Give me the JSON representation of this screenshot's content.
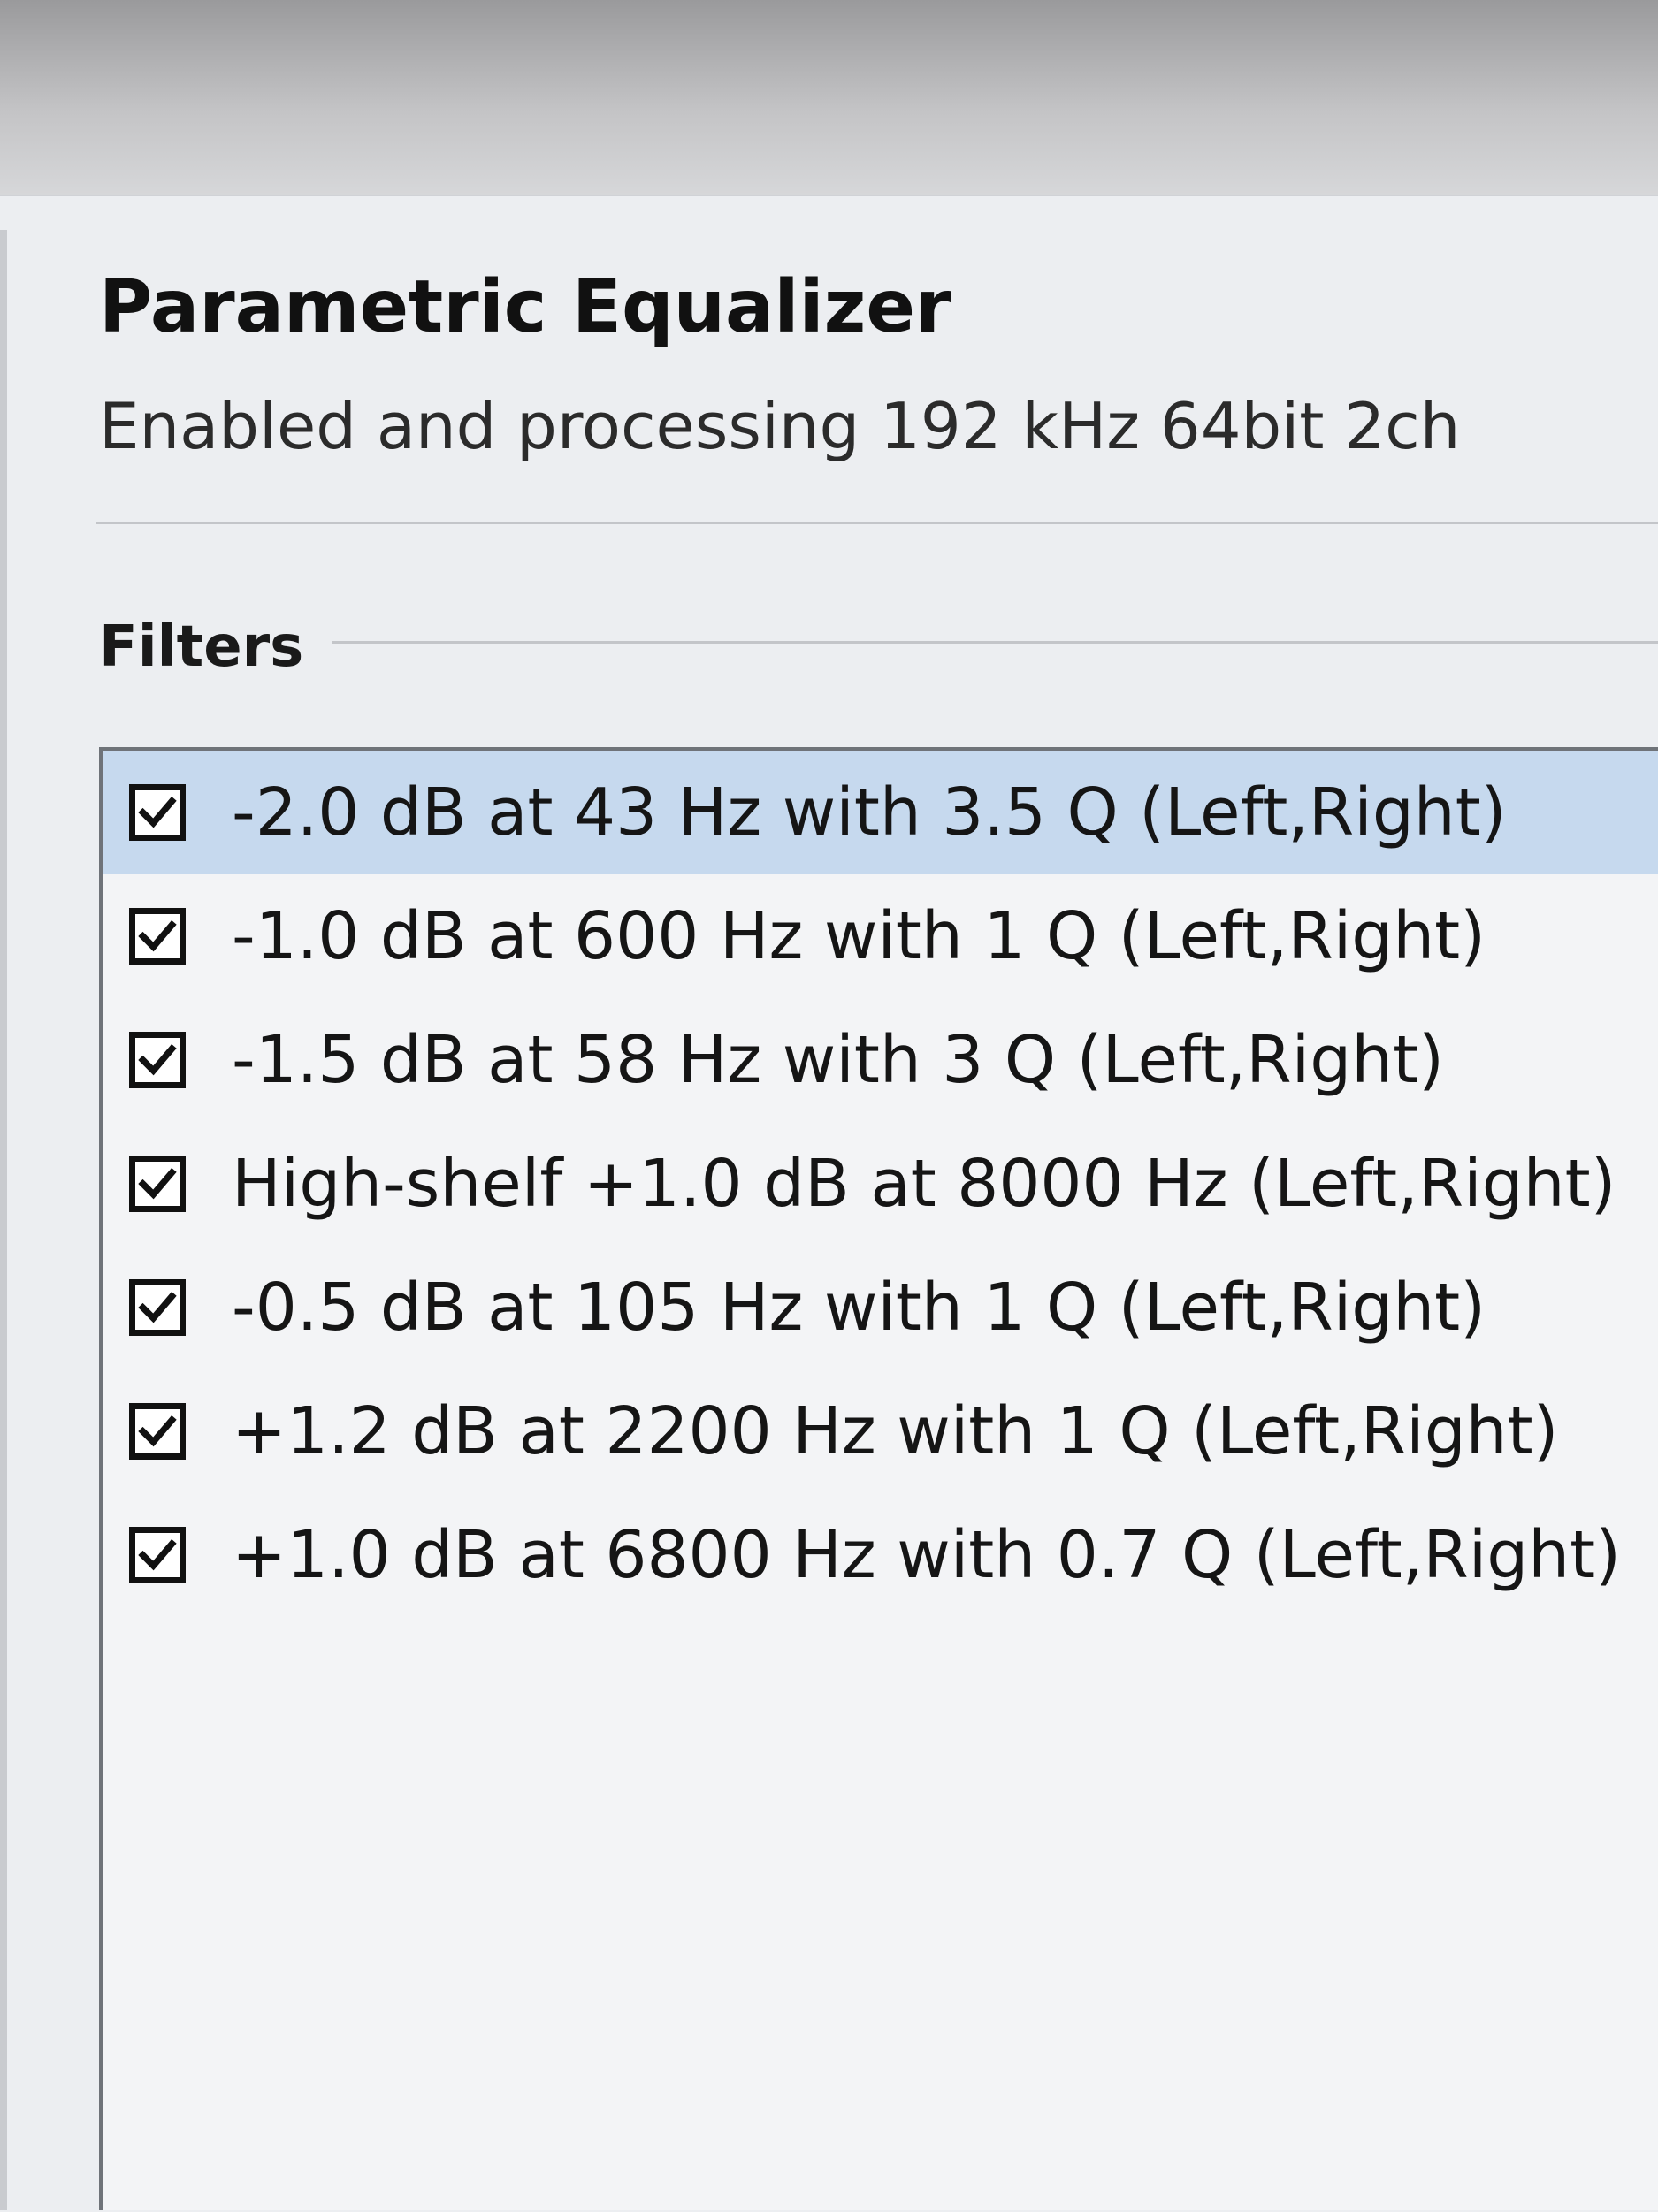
{
  "window": {
    "title": "Parametric Equalizer",
    "status": "Enabled and processing 192 kHz 64bit 2ch"
  },
  "filters_section": {
    "label": "Filters",
    "items": [
      {
        "label": "-2.0 dB at 43 Hz with 3.5 Q (Left,Right)",
        "checked": true,
        "selected": true
      },
      {
        "label": "-1.0 dB at 600 Hz with 1 Q (Left,Right)",
        "checked": true,
        "selected": false
      },
      {
        "label": "-1.5 dB at 58 Hz with 3 Q (Left,Right)",
        "checked": true,
        "selected": false
      },
      {
        "label": "High-shelf +1.0 dB at 8000 Hz (Left,Right)",
        "checked": true,
        "selected": false
      },
      {
        "label": "-0.5 dB at 105 Hz with 1 Q (Left,Right)",
        "checked": true,
        "selected": false
      },
      {
        "label": "+1.2 dB at 2200 Hz with 1 Q (Left,Right)",
        "checked": true,
        "selected": false
      },
      {
        "label": "+1.0 dB at 6800 Hz with 0.7 Q (Left,Right)",
        "checked": true,
        "selected": false
      }
    ]
  },
  "colors": {
    "selection": "#c6d9ee",
    "checkbox_border": "#111111",
    "panel_background": "#eceef1"
  },
  "icons": {
    "checkbox": "checkmark-icon"
  }
}
